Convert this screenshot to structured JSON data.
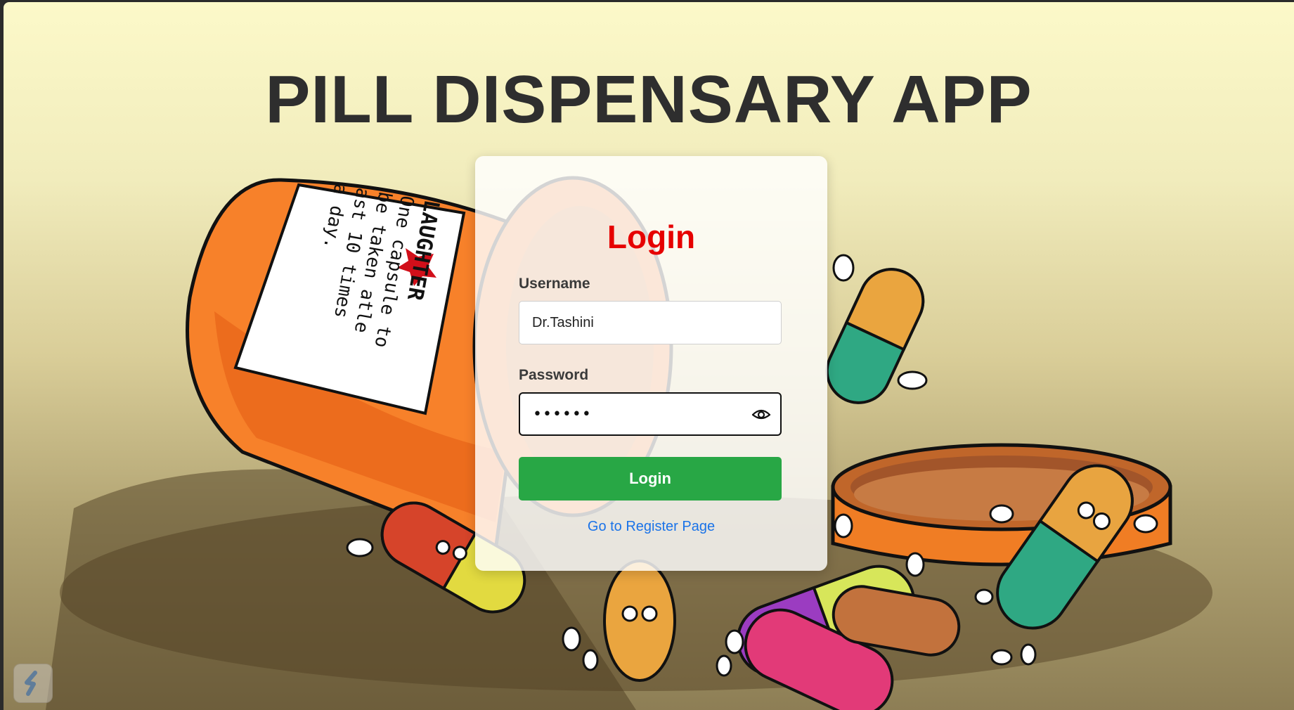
{
  "app": {
    "title": "PILL DISPENSARY APP"
  },
  "background": {
    "label_line_1": "LAUGHTER",
    "label_line_2": "One capsule to",
    "label_line_3": "be taken atle",
    "label_line_4": "ast 10 times",
    "label_line_5": "a day."
  },
  "login": {
    "heading": "Login",
    "username_label": "Username",
    "username_value": "Dr.Tashini",
    "password_label": "Password",
    "password_value": "••••••",
    "submit_label": "Login",
    "register_link": "Go to Register Page"
  },
  "colors": {
    "heading": "#e60000",
    "button": "#28a745",
    "link": "#1a73e8"
  },
  "icons": {
    "password_toggle": "eye-icon",
    "corner_widget": "app-widget-icon"
  }
}
